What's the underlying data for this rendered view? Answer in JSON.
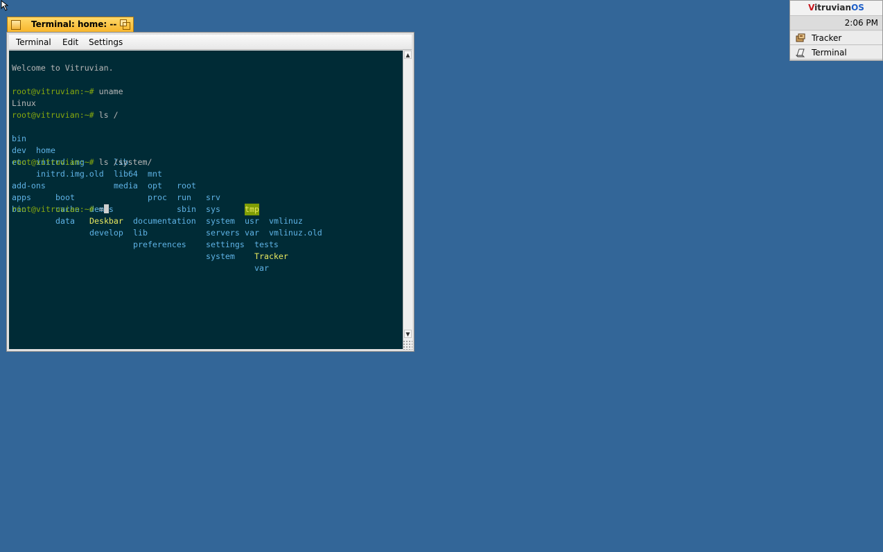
{
  "window": {
    "title": "Terminal: home: --",
    "menu": [
      "Terminal",
      "Edit",
      "Settings"
    ]
  },
  "terminal": {
    "welcome": "Welcome to Vitruvian.",
    "prompt": "root@vitruvian:~#",
    "cmd1": "uname",
    "out1": "Linux",
    "cmd2": "ls /",
    "ls_root": {
      "row1": [
        "bin",
        "home",
        "lib",
        "mnt",
        "root",
        "srv",
        "tmp",
        "vmlinuz"
      ],
      "row2": [
        "dev",
        "initrd.img",
        "lib64",
        "opt",
        "run",
        "sys",
        "usr",
        "vmlinuz.old"
      ],
      "row3": [
        "etc",
        "initrd.img.old",
        "media",
        "proc",
        "sbin",
        "system",
        "var"
      ]
    },
    "cmd3": "ls /system/",
    "ls_system": {
      "row1": [
        "add-ons",
        "boot",
        "demos",
        "documentation",
        "servers",
        "tests"
      ],
      "row2": [
        "apps",
        "cache",
        "Deskbar",
        "lib",
        "settings",
        "Tracker"
      ],
      "row3": [
        "bin",
        "data",
        "develop",
        "preferences",
        "system",
        "var"
      ]
    },
    "typed": "="
  },
  "deskbar": {
    "logo_v": "V",
    "logo_rest": "itruvian",
    "logo_os": "OS",
    "clock": "2:06 PM",
    "items": [
      {
        "label": "Tracker",
        "icon": "tracker-icon"
      },
      {
        "label": "Terminal",
        "icon": "terminal-icon"
      }
    ]
  },
  "colors": {
    "desktop": "#336698",
    "terminal_bg": "#002b36",
    "prompt": "#86a80e",
    "directory": "#5fb3e6",
    "executable": "#e8e85f",
    "window_tab": "#f8b62c"
  }
}
